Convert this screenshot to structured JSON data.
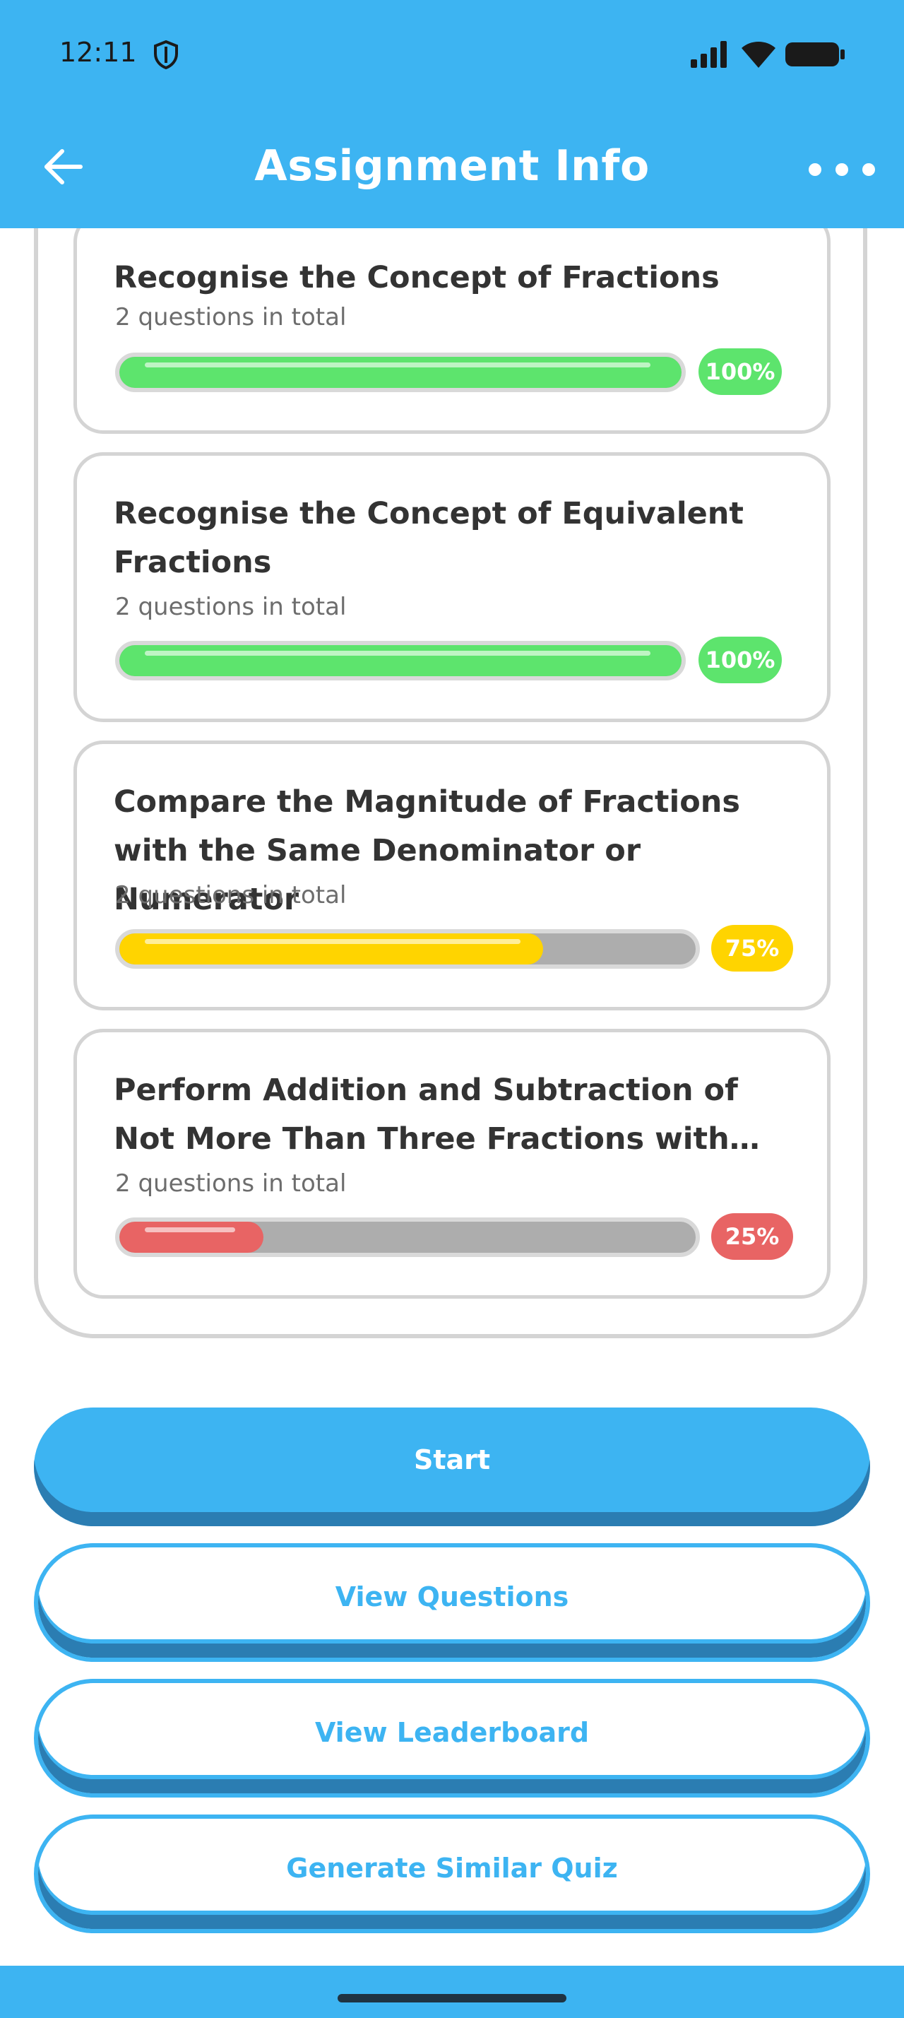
{
  "status_bar": {
    "time": "12:11"
  },
  "header": {
    "title": "Assignment Info"
  },
  "topics": [
    {
      "title": "Recognise the Concept of Fractions",
      "subtitle": "2 questions in total",
      "percent_label": "100%",
      "progress": 1.0,
      "color": "#5de46d"
    },
    {
      "title": "Recognise the Concept of Equivalent Fractions",
      "subtitle": "2 questions in total",
      "percent_label": "100%",
      "progress": 1.0,
      "color": "#5de46d"
    },
    {
      "title": "Compare the Magnitude of Fractions with the Same Denominator or Numerator",
      "subtitle": "2 questions in total",
      "percent_label": "75%",
      "progress": 0.75,
      "color": "#ffd400"
    },
    {
      "title": "Perform Addition and Subtraction of Not More Than Three Fractions with the Same Denominator",
      "subtitle": "2 questions in total",
      "percent_label": "25%",
      "progress": 0.25,
      "color": "#e86464"
    }
  ],
  "buttons": {
    "start": "Start",
    "view_questions": "View Questions",
    "view_leaderboard": "View Leaderboard",
    "generate_similar_quiz": "Generate Similar Quiz"
  },
  "colors": {
    "brand": "#3db4f2",
    "brand_dark": "#2b7db2",
    "card_border": "#d4d4d4",
    "track": "#adadad"
  },
  "icons": {
    "back": "arrow-left-icon",
    "more": "more-horizontal-icon",
    "shield": "shield-icon",
    "signal": "signal-icon",
    "wifi": "wifi-icon",
    "battery": "battery-icon"
  }
}
